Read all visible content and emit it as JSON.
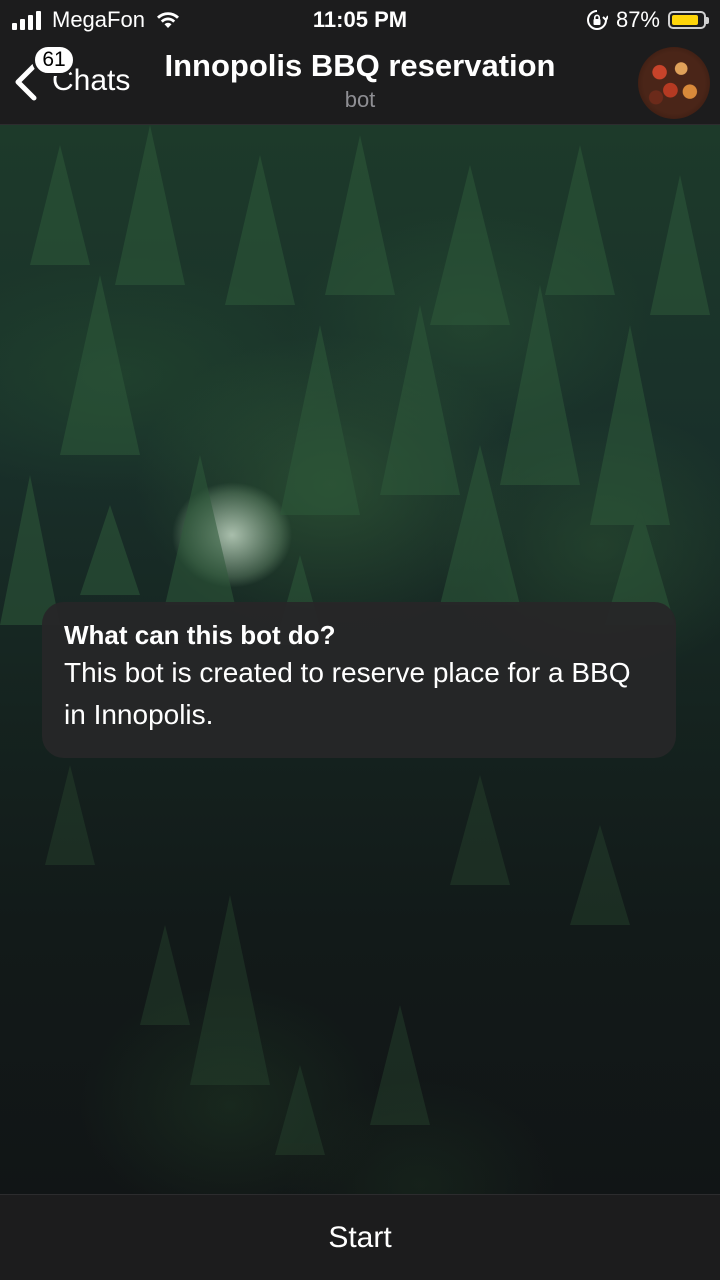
{
  "status_bar": {
    "carrier": "MegaFon",
    "time": "11:05 PM",
    "battery_percent": "87%",
    "battery_level": 0.87,
    "icons": [
      "signal-icon",
      "wifi-icon",
      "rotation-lock-icon",
      "battery-icon"
    ]
  },
  "nav": {
    "back_label": "Chats",
    "unread_count": "61",
    "title": "Innopolis BBQ reservation",
    "subtitle": "bot"
  },
  "bot_info": {
    "title": "What can this bot do?",
    "description": "This bot is created to reserve place for a BBQ in Innopolis."
  },
  "bottom": {
    "start_label": "Start"
  },
  "colors": {
    "bar_background": "#1c1c1d",
    "bubble_background": "#262628",
    "battery": "#ffd60a",
    "subtitle": "#8e8e93"
  }
}
